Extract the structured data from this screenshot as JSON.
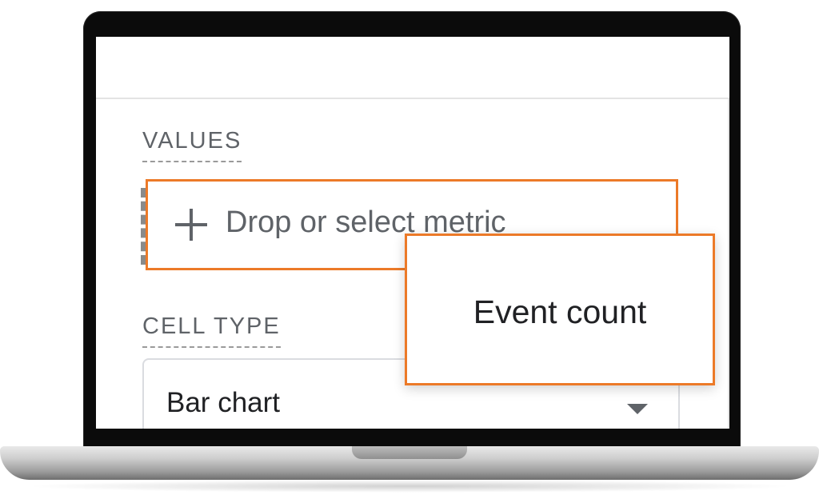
{
  "values_section": {
    "label": "VALUES",
    "drop_placeholder": "Drop or select metric",
    "add_icon": "plus-icon"
  },
  "tooltip": {
    "text": "Event count"
  },
  "cell_type_section": {
    "label": "CELL TYPE",
    "selected_value": "Bar chart",
    "dropdown_icon": "chevron-down-icon"
  },
  "colors": {
    "highlight": "#ec7a28",
    "label_text": "#5f6368",
    "primary_text": "#202124"
  }
}
